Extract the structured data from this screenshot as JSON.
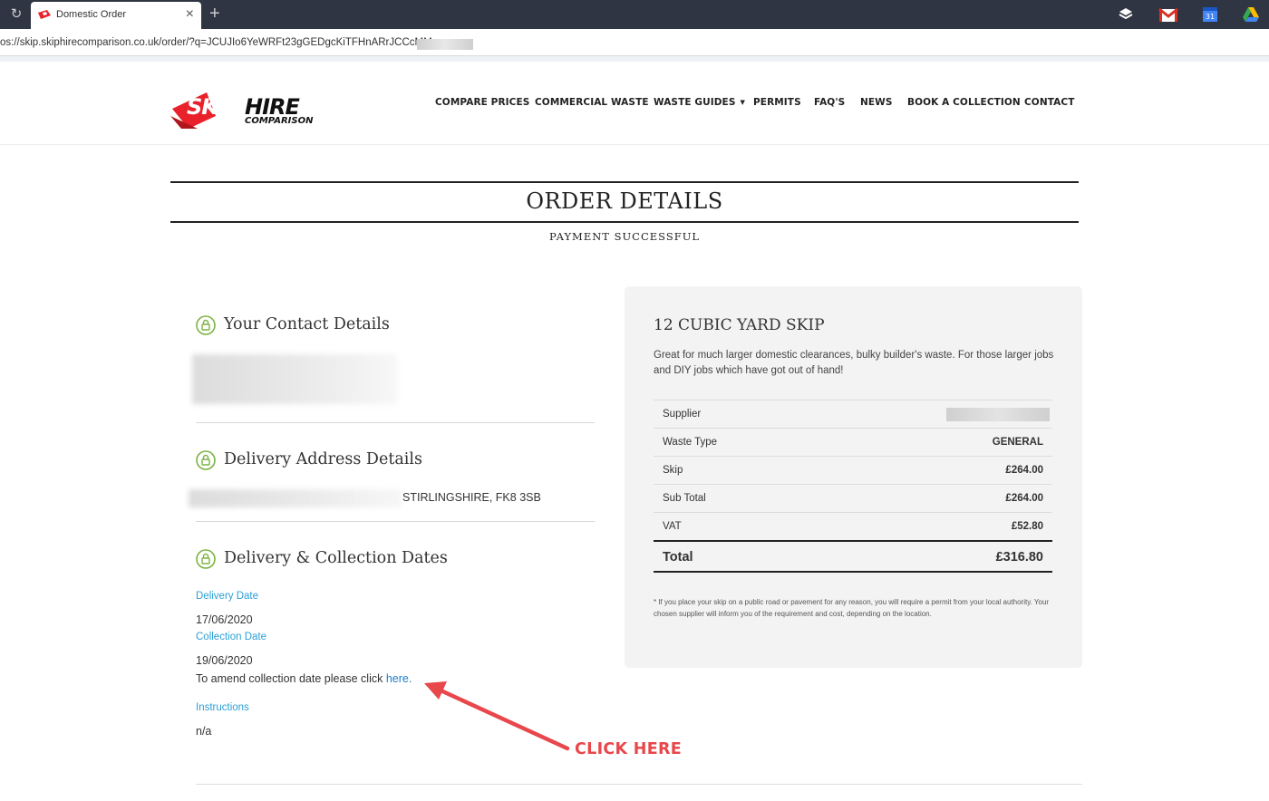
{
  "browser": {
    "tab_title": "Domestic Order",
    "url": "os://skip.skiphirecomparison.co.uk/order/?q=JCUJIo6YeWRFt23gGEDgcKiTFHnARrJCCcMM",
    "new_tab": "+",
    "close": "×",
    "reload": "↻"
  },
  "brand": {
    "logo_main": "SKIPHIRE",
    "logo_sub": "COMPARISON",
    "accent": "#e8212b"
  },
  "nav": {
    "items": [
      "COMPARE PRICES",
      "COMMERCIAL WASTE",
      "WASTE GUIDES",
      "PERMITS",
      "FAQ'S",
      "NEWS",
      "BOOK A COLLECTION",
      "CONTACT"
    ]
  },
  "order": {
    "title": "ORDER DETAILS",
    "status": "PAYMENT SUCCESSFUL"
  },
  "contact": {
    "title": "Your Contact Details"
  },
  "delivery_address": {
    "title": "Delivery Address Details",
    "visible_text": "STIRLINGSHIRE, FK8 3SB"
  },
  "dates": {
    "title": "Delivery & Collection Dates",
    "delivery_label": "Delivery Date",
    "delivery_value": "17/06/2020",
    "collection_label": "Collection Date",
    "collection_value": "19/06/2020",
    "amend_text": "To amend collection date please click ",
    "amend_link": "here.",
    "instructions_label": "Instructions",
    "instructions_value": "n/a"
  },
  "skip": {
    "title": "12 CUBIC YARD SKIP",
    "description": "Great for much larger domestic clearances, bulky builder's waste. For those larger jobs and DIY jobs which have got out of hand!",
    "rows": [
      {
        "label": "Supplier",
        "value": ""
      },
      {
        "label": "Waste Type",
        "value": "GENERAL"
      },
      {
        "label": "Skip",
        "value": "£264.00"
      },
      {
        "label": "Sub Total",
        "value": "£264.00"
      },
      {
        "label": "VAT",
        "value": "£52.80"
      }
    ],
    "total_label": "Total",
    "total_value": "£316.80",
    "note": "* If you place your skip on a public road or pavement for any reason, you will require a permit from your local authority. Your chosen supplier will inform you of the requirement and cost, depending on the location."
  },
  "annotation": {
    "label": "CLICK HERE",
    "color": "#e8474b"
  }
}
